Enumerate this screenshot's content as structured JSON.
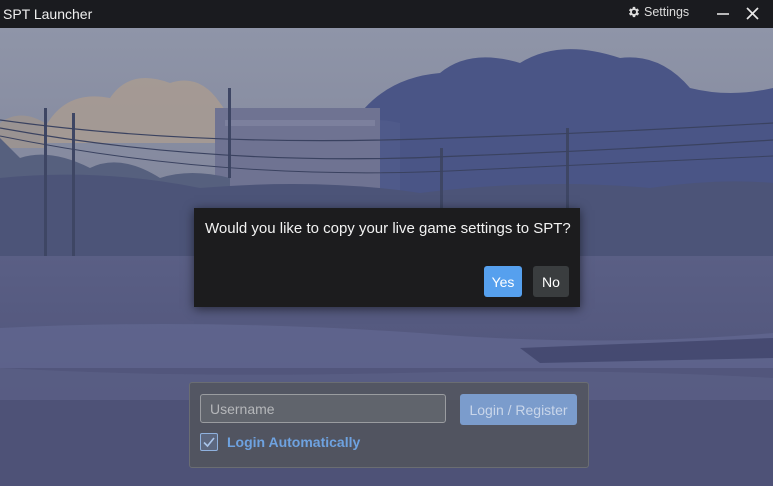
{
  "window": {
    "title": "SPT Launcher",
    "settings_label": "Settings",
    "icons": {
      "settings": "gear-icon",
      "minimize": "minimize-icon",
      "close": "close-icon"
    }
  },
  "dialog": {
    "message": "Would you like to copy your live game settings to SPT?",
    "yes_label": "Yes",
    "no_label": "No"
  },
  "login": {
    "username_value": "",
    "username_placeholder": "Username",
    "login_button_label": "Login / Register",
    "auto_login_label": "Login Automatically",
    "auto_login_checked": true
  },
  "colors": {
    "accent": "#56a0ee",
    "titlebar": "#1a1b1f",
    "dialog_bg": "#1c1c1e",
    "link": "#6ea2e0"
  }
}
